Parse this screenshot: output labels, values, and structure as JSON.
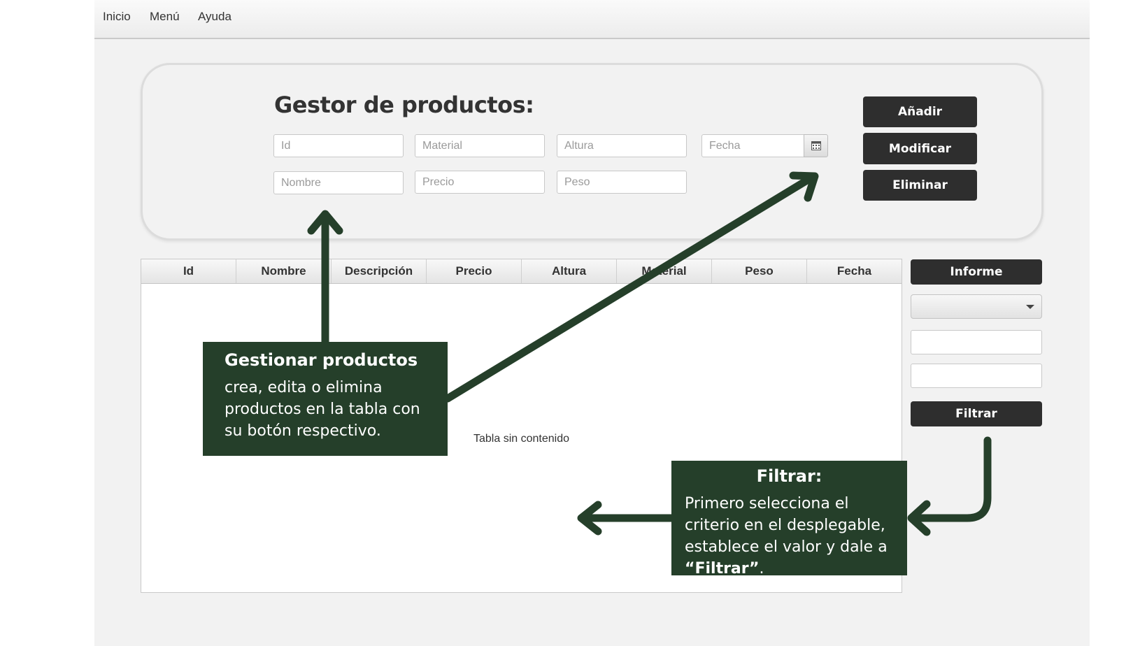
{
  "menubar": {
    "items": [
      "Inicio",
      "Menú",
      "Ayuda"
    ]
  },
  "form": {
    "title": "Gestor de productos:",
    "placeholders": {
      "id": "Id",
      "material": "Material",
      "altura": "Altura",
      "fecha": "Fecha",
      "nombre": "Nombre",
      "precio": "Precio",
      "peso": "Peso"
    },
    "buttons": {
      "add": "Añadir",
      "modify": "Modificar",
      "delete": "Eliminar"
    }
  },
  "table": {
    "columns": [
      "Id",
      "Nombre",
      "Descripción",
      "Precio",
      "Altura",
      "Material",
      "Peso",
      "Fecha"
    ],
    "empty_message": "Tabla sin contenido"
  },
  "sidebar": {
    "report_label": "Informe",
    "filter_label": "Filtrar",
    "select_value": ""
  },
  "callouts": {
    "manage": {
      "title": "Gestionar productos",
      "text": "crea, edita o elimina productos en la tabla con su botón respectivo."
    },
    "filter": {
      "title": "Filtrar:",
      "text_before": "Primero selecciona el criterio en el desplegable, establece el valor y dale a ",
      "text_bold": "“Filtrar”",
      "text_after": "."
    }
  },
  "colors": {
    "callout_bg": "#253f2a",
    "button_bg": "#2e2e2e",
    "arrow": "#253f2a"
  },
  "icons": {
    "calendar": "calendar-icon",
    "dropdown": "chevron-down-icon"
  }
}
